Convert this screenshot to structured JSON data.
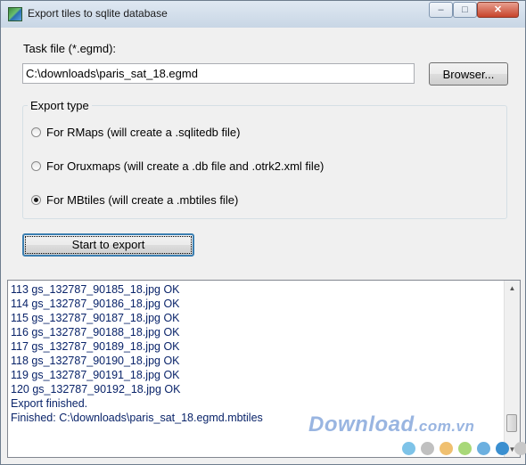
{
  "window": {
    "title": "Export tiles to sqlite database",
    "controls": {
      "minimize": "–",
      "maximize": "□",
      "close": "✕"
    }
  },
  "task": {
    "label": "Task file (*.egmd):",
    "value": "C:\\downloads\\paris_sat_18.egmd",
    "browse_label": "Browser..."
  },
  "export_type": {
    "title": "Export type",
    "options": [
      {
        "label": "For RMaps (will create a .sqlitedb file)",
        "checked": false
      },
      {
        "label": "For Oruxmaps (will create a .db file and .otrk2.xml file)",
        "checked": false
      },
      {
        "label": "For MBtiles (will create a .mbtiles file)",
        "checked": true
      }
    ]
  },
  "start_button": {
    "label": "Start to export"
  },
  "log": {
    "lines": [
      "113 gs_132787_90185_18.jpg OK",
      "114 gs_132787_90186_18.jpg OK",
      "115 gs_132787_90187_18.jpg OK",
      "116 gs_132787_90188_18.jpg OK",
      "117 gs_132787_90189_18.jpg OK",
      "118 gs_132787_90190_18.jpg OK",
      "119 gs_132787_90191_18.jpg OK",
      "120 gs_132787_90192_18.jpg OK",
      "Export finished.",
      "Finished: C:\\downloads\\paris_sat_18.egmd.mbtiles"
    ],
    "scroll_up_icon": "▲",
    "scroll_down_icon": "▼"
  },
  "watermark": {
    "main": "Download",
    "tld": ".com.vn",
    "dot_colors": [
      "#7ec3e8",
      "#c0c0c0",
      "#f0c070",
      "#a8d878",
      "#6cb0e0",
      "#3a8fd0",
      "#c8c8c8"
    ]
  },
  "icons": {
    "app": "map-export-icon",
    "scroll_up": "chevron-up-icon",
    "scroll_down": "chevron-down-icon"
  }
}
